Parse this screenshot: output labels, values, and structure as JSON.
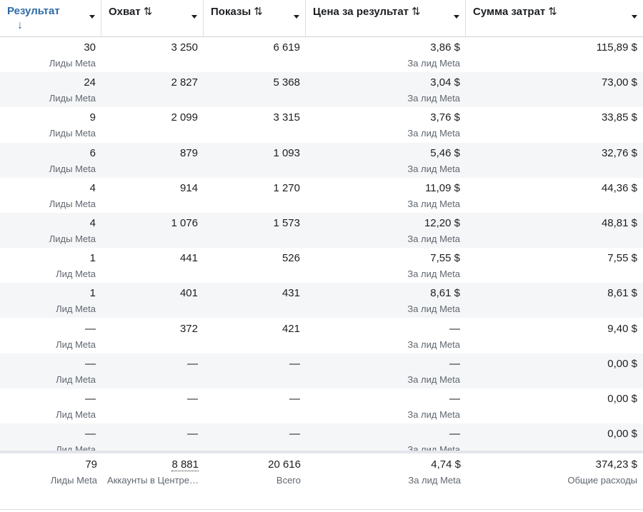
{
  "header": {
    "columns": [
      {
        "label": "Результат",
        "sort_icon": "↓",
        "active": true
      },
      {
        "label": "Охват",
        "sort_icon": "⇅"
      },
      {
        "label": "Показы",
        "sort_icon": "⇅"
      },
      {
        "label": "Цена за результат",
        "sort_icon": "⇅"
      },
      {
        "label": "Сумма затрат",
        "sort_icon": "⇅"
      }
    ]
  },
  "rows": [
    {
      "result": "30",
      "result_sub": "Лиды Meta",
      "reach": "3 250",
      "impressions": "6 619",
      "cost": "3,86 $",
      "cost_sub": "За лид Meta",
      "spend": "115,89 $"
    },
    {
      "result": "24",
      "result_sub": "Лиды Meta",
      "reach": "2 827",
      "impressions": "5 368",
      "cost": "3,04 $",
      "cost_sub": "За лид Meta",
      "spend": "73,00 $"
    },
    {
      "result": "9",
      "result_sub": "Лиды Meta",
      "reach": "2 099",
      "impressions": "3 315",
      "cost": "3,76 $",
      "cost_sub": "За лид Meta",
      "spend": "33,85 $"
    },
    {
      "result": "6",
      "result_sub": "Лиды Meta",
      "reach": "879",
      "impressions": "1 093",
      "cost": "5,46 $",
      "cost_sub": "За лид Meta",
      "spend": "32,76 $"
    },
    {
      "result": "4",
      "result_sub": "Лиды Meta",
      "reach": "914",
      "impressions": "1 270",
      "cost": "11,09 $",
      "cost_sub": "За лид Meta",
      "spend": "44,36 $"
    },
    {
      "result": "4",
      "result_sub": "Лиды Meta",
      "reach": "1 076",
      "impressions": "1 573",
      "cost": "12,20 $",
      "cost_sub": "За лид Meta",
      "spend": "48,81 $"
    },
    {
      "result": "1",
      "result_sub": "Лид Meta",
      "reach": "441",
      "impressions": "526",
      "cost": "7,55 $",
      "cost_sub": "За лид Meta",
      "spend": "7,55 $"
    },
    {
      "result": "1",
      "result_sub": "Лид Meta",
      "reach": "401",
      "impressions": "431",
      "cost": "8,61 $",
      "cost_sub": "За лид Meta",
      "spend": "8,61 $"
    },
    {
      "result": "—",
      "result_sub": "Лид Meta",
      "reach": "372",
      "impressions": "421",
      "cost": "—",
      "cost_sub": "За лид Meta",
      "spend": "9,40 $"
    },
    {
      "result": "—",
      "result_sub": "Лид Meta",
      "reach": "—",
      "impressions": "—",
      "cost": "—",
      "cost_sub": "За лид Meta",
      "spend": "0,00 $"
    },
    {
      "result": "—",
      "result_sub": "Лид Meta",
      "reach": "—",
      "impressions": "—",
      "cost": "—",
      "cost_sub": "За лид Meta",
      "spend": "0,00 $"
    },
    {
      "result": "—",
      "result_sub": "Лид Meta",
      "reach": "—",
      "impressions": "—",
      "cost": "—",
      "cost_sub": "За лид Meta",
      "spend": "0,00 $"
    }
  ],
  "totals": {
    "result": "79",
    "result_sub": "Лиды Meta",
    "reach": "8 881",
    "reach_sub": "Аккаунты в Центре…",
    "impressions": "20 616",
    "impressions_sub": "Всего",
    "cost": "4,74 $",
    "cost_sub": "За лид Meta",
    "spend": "374,23 $",
    "spend_sub": "Общие расходы"
  },
  "colors": {
    "accent": "#2d6ba7",
    "row_alt": "#f5f6f7",
    "text": "#1c1e21",
    "muted": "#606770"
  }
}
